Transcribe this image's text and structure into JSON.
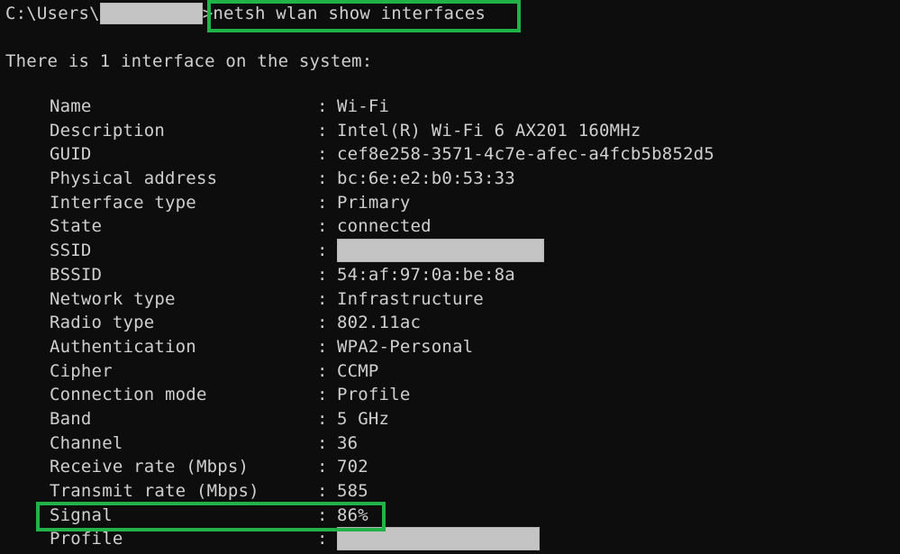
{
  "terminal": {
    "background_color": "#0d0d0d",
    "text_color": "#cfcfcf",
    "highlight_color": "#22b24a",
    "redaction_color": "#c4c4c4"
  },
  "prompt": {
    "path": "C:\\Users\\",
    "username_redacted": "",
    "caret": ">",
    "command": "netsh wlan show interfaces"
  },
  "output": {
    "headline": "There is 1 interface on the system:",
    "separator": ":",
    "rows": [
      {
        "label": "Name",
        "value": "Wi-Fi",
        "redacted": false
      },
      {
        "label": "Description",
        "value": "Intel(R) Wi-Fi 6 AX201 160MHz",
        "redacted": false
      },
      {
        "label": "GUID",
        "value": "cef8e258-3571-4c7e-afec-a4fcb5b852d5",
        "redacted": false
      },
      {
        "label": "Physical address",
        "value": "bc:6e:e2:b0:53:33",
        "redacted": false
      },
      {
        "label": "Interface type",
        "value": "Primary",
        "redacted": false
      },
      {
        "label": "State",
        "value": "connected",
        "redacted": false
      },
      {
        "label": "SSID",
        "value": "",
        "redacted": true
      },
      {
        "label": "BSSID",
        "value": "54:af:97:0a:be:8a",
        "redacted": false
      },
      {
        "label": "Network type",
        "value": "Infrastructure",
        "redacted": false
      },
      {
        "label": "Radio type",
        "value": "802.11ac",
        "redacted": false
      },
      {
        "label": "Authentication",
        "value": "WPA2-Personal",
        "redacted": false
      },
      {
        "label": "Cipher",
        "value": "CCMP",
        "redacted": false
      },
      {
        "label": "Connection mode",
        "value": "Profile",
        "redacted": false
      },
      {
        "label": "Band",
        "value": "5 GHz",
        "redacted": false
      },
      {
        "label": "Channel",
        "value": "36",
        "redacted": false
      },
      {
        "label": "Receive rate (Mbps)",
        "value": "702",
        "redacted": false
      },
      {
        "label": "Transmit rate (Mbps)",
        "value": "585",
        "redacted": false
      },
      {
        "label": "Signal",
        "value": "86%",
        "redacted": false
      },
      {
        "label": "Profile",
        "value": "",
        "redacted": true
      }
    ]
  },
  "annotations": [
    {
      "name": "command-highlight",
      "target": "netsh wlan show interfaces",
      "color": "#22b24a"
    },
    {
      "name": "signal-highlight",
      "target": "Signal : 86%",
      "color": "#22b24a"
    }
  ]
}
